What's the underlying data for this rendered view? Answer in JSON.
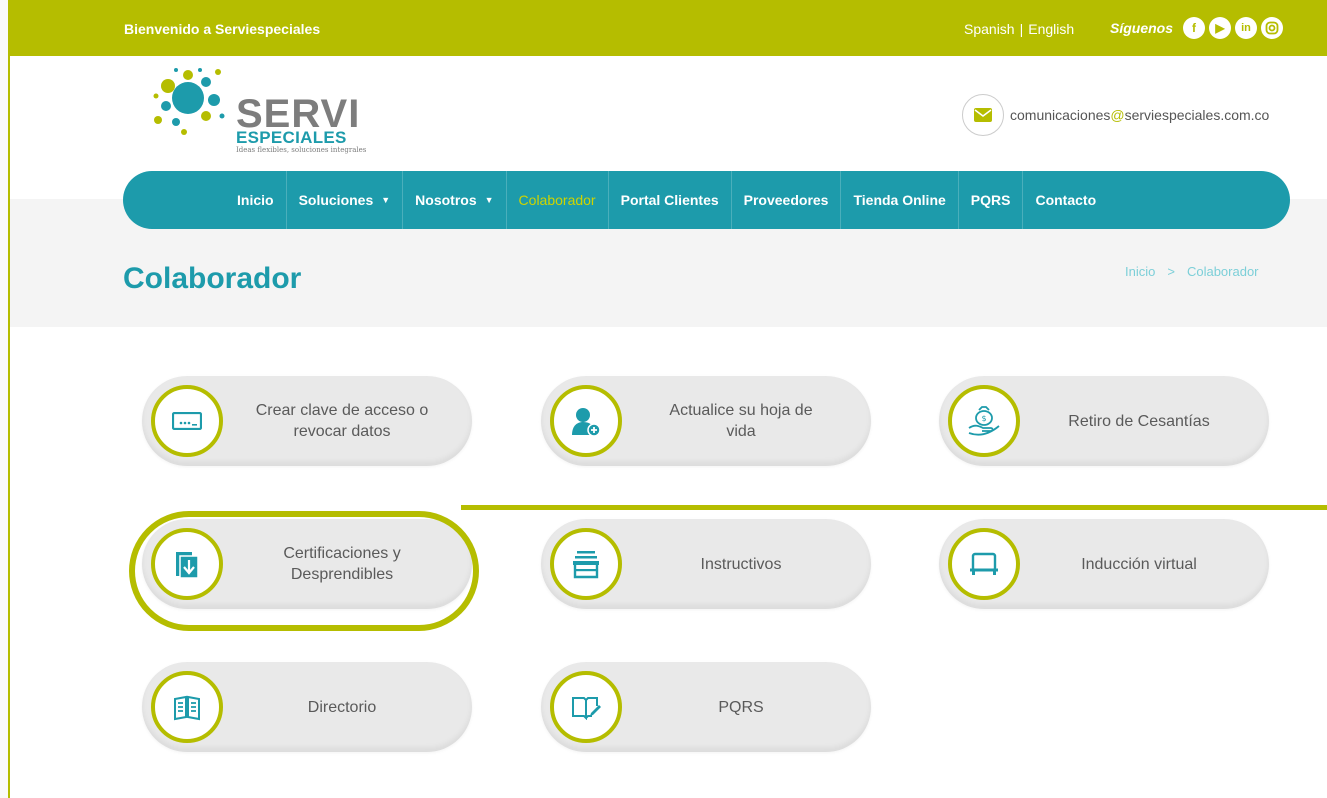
{
  "topbar": {
    "welcome": "Bienvenido a Serviespeciales",
    "lang_spanish": "Spanish",
    "lang_separator": "|",
    "lang_english": "English",
    "follow_label": "Síguenos",
    "socials": [
      {
        "name": "facebook-icon",
        "glyph": "f"
      },
      {
        "name": "youtube-icon",
        "glyph": "▶"
      },
      {
        "name": "linkedin-icon",
        "glyph": "in"
      },
      {
        "name": "instagram-icon",
        "glyph": "◎"
      }
    ]
  },
  "logo": {
    "line1": "SERVI",
    "line2": "ESPECIALES",
    "tagline": "Ideas flexibles, soluciones integrales"
  },
  "contact": {
    "email_user": "comunicaciones",
    "email_at": "@",
    "email_domain": "serviespeciales.com.co"
  },
  "nav": {
    "items": [
      {
        "label": "Inicio"
      },
      {
        "label": "Soluciones",
        "caret": "▼"
      },
      {
        "label": "Nosotros",
        "caret": "▼"
      },
      {
        "label": "Colaborador"
      },
      {
        "label": "Portal Clientes"
      },
      {
        "label": "Proveedores"
      },
      {
        "label": "Tienda Online"
      },
      {
        "label": "PQRS"
      },
      {
        "label": "Contacto"
      }
    ]
  },
  "page": {
    "title": "Colaborador",
    "breadcrumb_home": "Inicio",
    "breadcrumb_sep": ">",
    "breadcrumb_current": "Colaborador"
  },
  "cards": [
    {
      "label": "Crear clave de acceso o revocar datos",
      "icon": "password-key-icon"
    },
    {
      "label": "Actualice su hoja de vida",
      "icon": "add-user-icon"
    },
    {
      "label": "Retiro de Cesantías",
      "icon": "money-bag-hand-icon"
    },
    {
      "label": "Certificaciones y Desprendibles",
      "icon": "download-document-icon"
    },
    {
      "label": "Instructivos",
      "icon": "stack-box-icon"
    },
    {
      "label": "Inducción virtual",
      "icon": "monitor-icon"
    },
    {
      "label": "Directorio",
      "icon": "directory-book-icon"
    },
    {
      "label": "PQRS",
      "icon": "book-edit-icon"
    }
  ],
  "colors": {
    "accent_green": "#b5bd00",
    "brand_teal": "#1d9bab"
  }
}
